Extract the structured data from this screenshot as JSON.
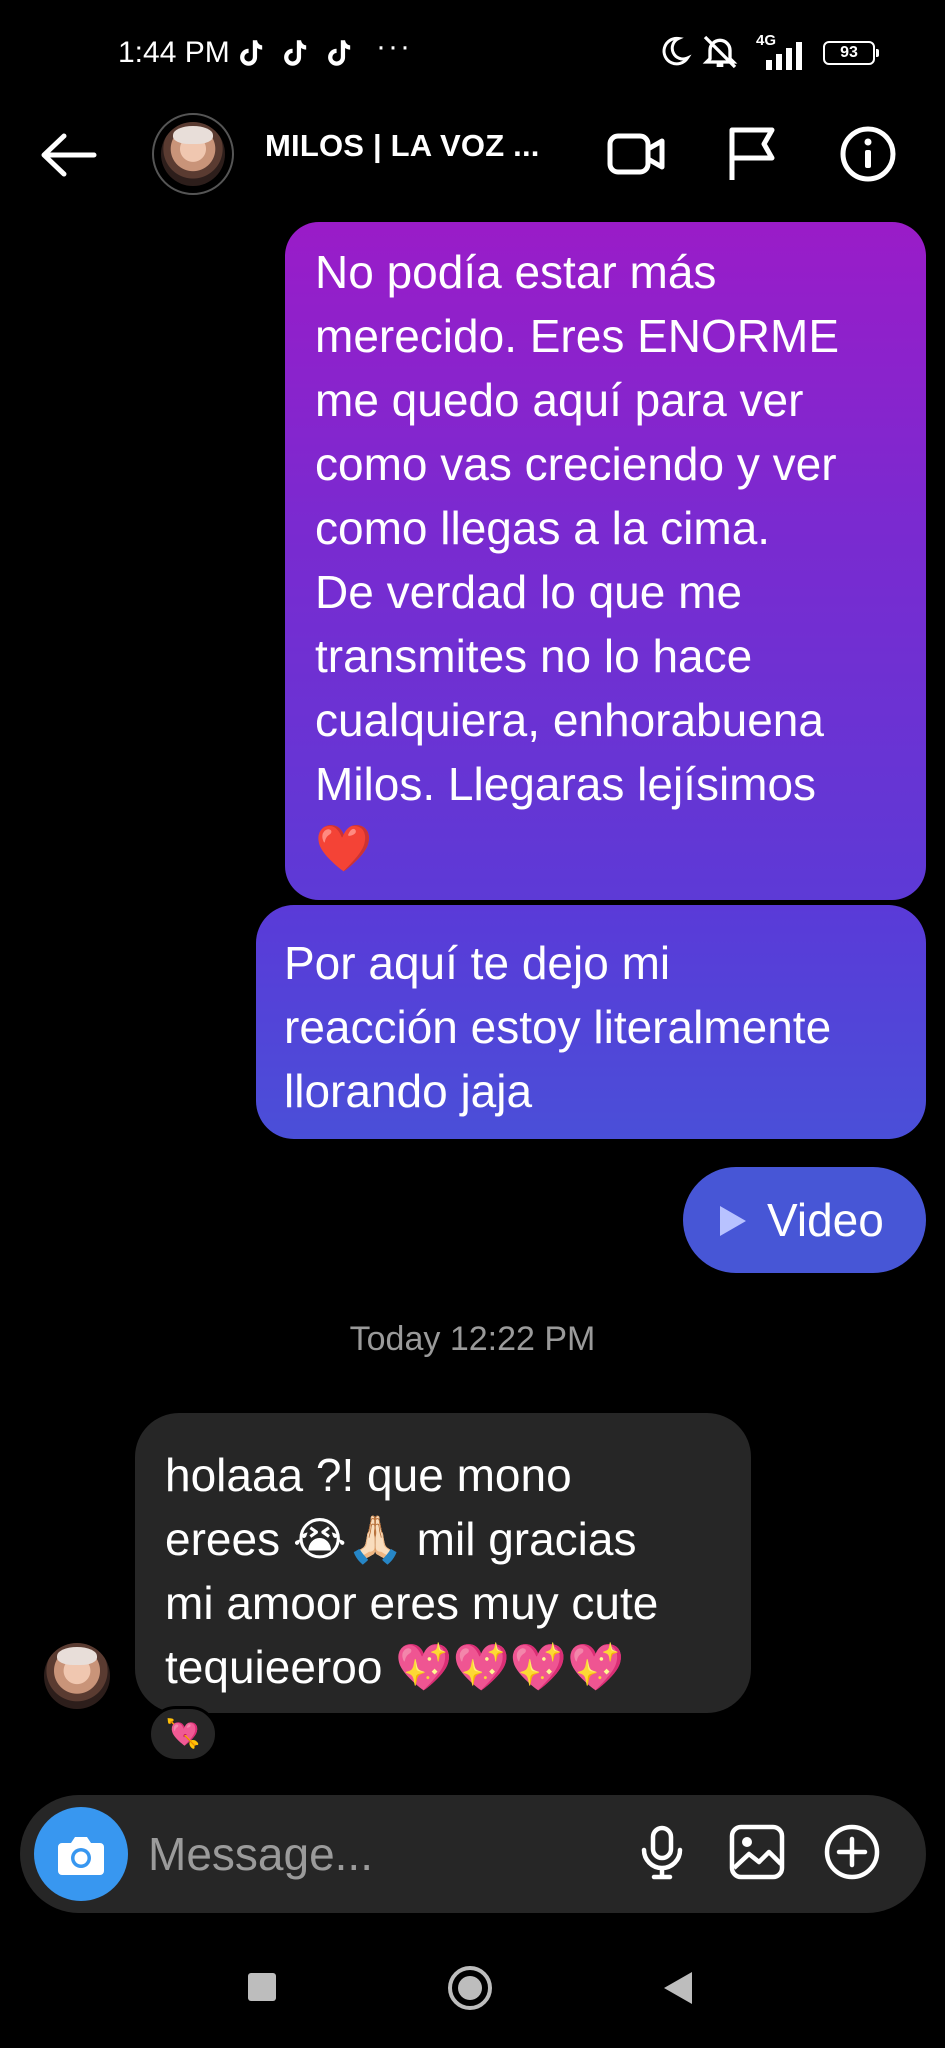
{
  "status_bar": {
    "time": "1:44 PM",
    "notification_icons": [
      "tiktok-icon",
      "tiktok-icon",
      "tiktok-icon"
    ],
    "more": "···",
    "network": "4G",
    "battery": "93"
  },
  "header": {
    "contact_name": "MILOS | LA VOZ ...",
    "icons": [
      "back-arrow-icon",
      "video-call-icon",
      "flag-icon",
      "info-icon"
    ]
  },
  "messages": {
    "sent_1": [
      "No podía estar más",
      "merecido. Eres ENORME",
      "me quedo aquí para ver",
      "como vas creciendo y ver",
      "como llegas a la cima.",
      "De verdad lo que me",
      "transmites no lo hace",
      "cualquiera, enhorabuena",
      "Milos. Llegaras lejísimos",
      "❤️"
    ],
    "sent_2": [
      "Por aquí te dejo mi",
      "reacción estoy literalmente",
      "llorando jaja"
    ],
    "sent_video_label": "Video",
    "timestamp": "Today 12:22 PM",
    "received_1": [
      "holaaa ?! que mono",
      "erees 😭🙏🏻 mil gracias",
      "mi amoor eres muy cute",
      "tequieeroo 💖💖💖💖"
    ],
    "reaction": "💘"
  },
  "composer": {
    "placeholder": "Message...",
    "icons": [
      "camera-icon",
      "microphone-icon",
      "gallery-icon",
      "add-icon"
    ]
  },
  "colors": {
    "background": "#000000",
    "sent_gradient_top": "#9a1cc8",
    "sent_gradient_bottom": "#4a4fd8",
    "received_bubble": "#262626",
    "camera_button": "#3897f0"
  }
}
